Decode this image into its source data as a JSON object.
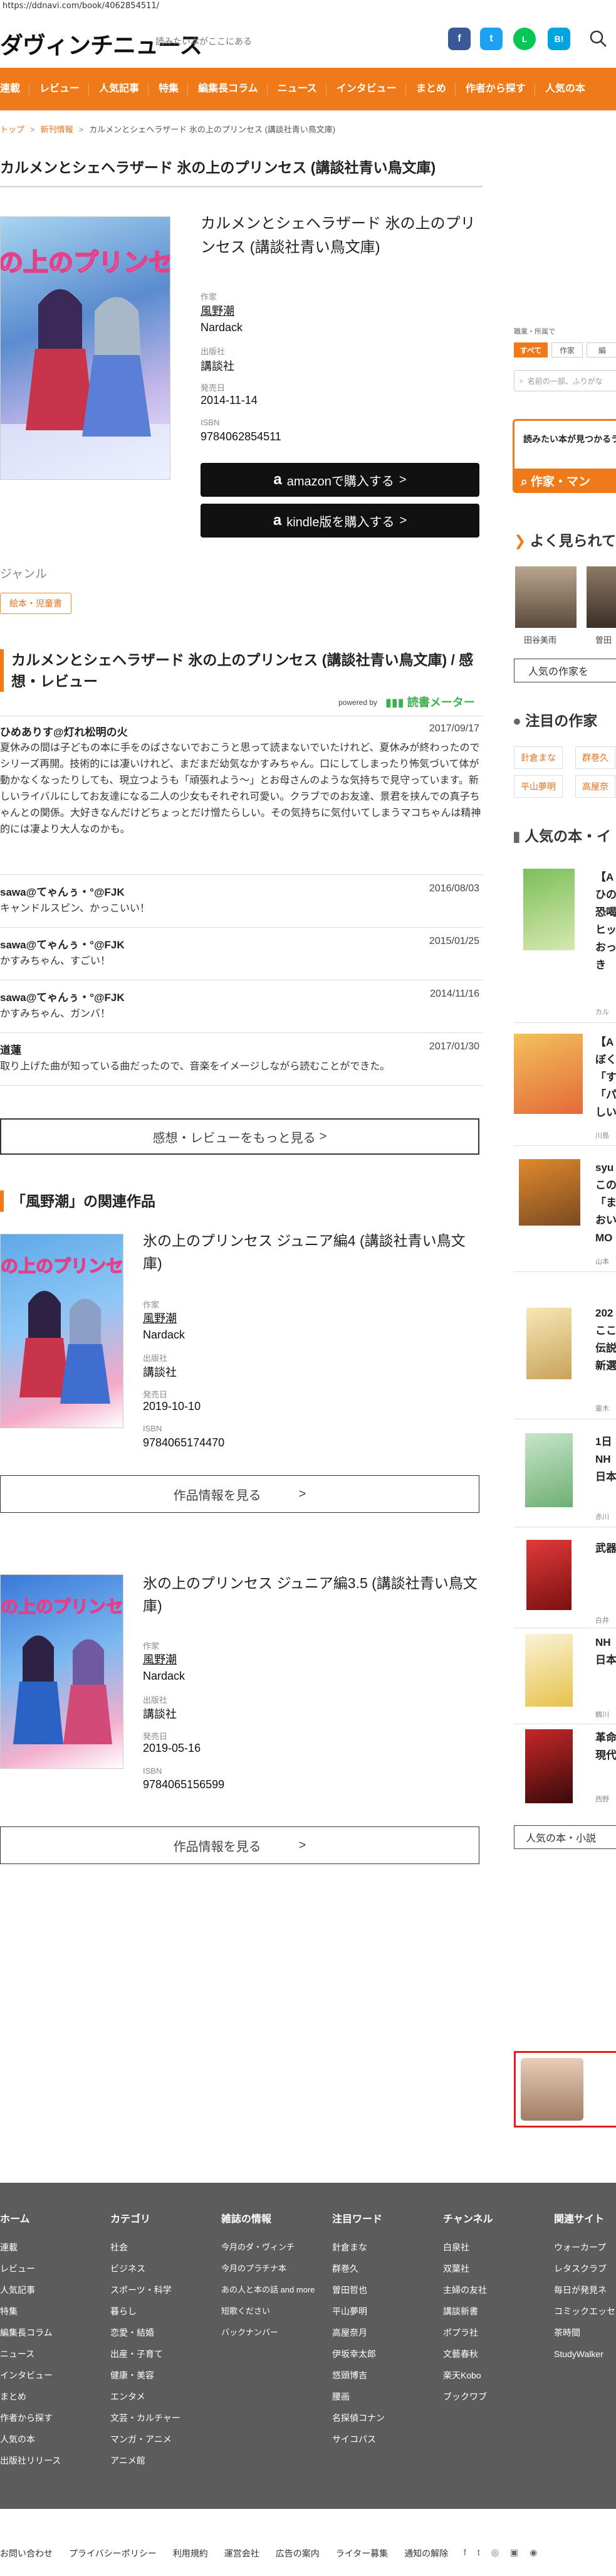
{
  "browser": {
    "url": "https://ddnavi.com/book/4062854511/"
  },
  "header": {
    "logo": "ダヴィンチニュース",
    "tagline": "読みたい本がここにある",
    "social": [
      {
        "name": "facebook-icon",
        "label": "f",
        "color": "#3b5998"
      },
      {
        "name": "twitter-icon",
        "label": "t",
        "color": "#1da1f2"
      },
      {
        "name": "line-icon",
        "label": "L",
        "color": "#06c755"
      },
      {
        "name": "hatena-icon",
        "label": "B!",
        "color": "#00a4de"
      }
    ]
  },
  "nav": [
    "連載",
    "レビュー",
    "人気記事",
    "特集",
    "編集長コラム",
    "ニュース",
    "インタビュー",
    "まとめ",
    "作者から探す",
    "人気の本"
  ],
  "breadcrumb": {
    "home": "トップ",
    "cat": "新刊情報",
    "current": "カルメンとシェヘラザード 氷の上のプリンセス (講談社青い鳥文庫)"
  },
  "page_title": "カルメンとシェヘラザード 氷の上のプリンセス (講談社青い鳥文庫)",
  "book": {
    "title": "カルメンとシェヘラザード 氷の上のプリンセス (講談社青い鳥文庫)",
    "author_label": "作家",
    "author": "風野潮",
    "illustrator": "Nardack",
    "publisher_label": "出版社",
    "publisher": "講談社",
    "release_label": "発売日",
    "release": "2014-11-14",
    "isbn_label": "ISBN",
    "isbn": "9784062854511",
    "amazon_btn": "amazonで購入する",
    "kindle_btn": "kindle版を購入する",
    "cover_text": "氷の上のプリンセス"
  },
  "genre": {
    "label": "ジャンル",
    "tag": "絵本・児童書"
  },
  "reviews": {
    "heading": "カルメンとシェヘラザード 氷の上のプリンセス (講談社青い鳥文庫) / 感想・レビュー",
    "powered": "powered by",
    "bookmeter": "読書メーター",
    "items": [
      {
        "user": "ひめありす@灯れ松明の火",
        "date": "2017/09/17",
        "text": "夏休みの間は子どもの本に手をのばさないでおこうと思って読まないでいたけれど、夏休みが終わったのでシリーズ再開。技術的には凄いけれど、まだまだ幼気なかすみちゃん。口にしてしまったり怖気づいて体が動かなくなったりしても、現立つようも「頑張れよう〜」とお母さんのような気持ちで見守っています。新しいライバルにしてお友達になる二人の少女もそれぞれ可愛い。クラブでのお友達、景君を挟んでの真子ちゃんとの関係。大好きなんだけどちょっとだけ憎たらしい。その気持ちに気付いてしまうマコちゃんは精神的には凄より大人なのかも。"
      },
      {
        "user": "sawa@てゃんぅ・°@FJK",
        "date": "2016/08/03",
        "text": "キャンドルスピン、かっこいい！"
      },
      {
        "user": "sawa@てゃんぅ・°@FJK",
        "date": "2015/01/25",
        "text": "かすみちゃん、すごい！"
      },
      {
        "user": "sawa@てゃんぅ・°@FJK",
        "date": "2014/11/16",
        "text": "かすみちゃん、ガンバ！"
      },
      {
        "user": "道蓮",
        "date": "2017/01/30",
        "text": "取り上げた曲が知っている曲だったので、音楽をイメージしながら読むことができた。"
      }
    ],
    "more": "感想・レビューをもっと見る"
  },
  "related": {
    "heading": "「風野潮」の関連作品",
    "items": [
      {
        "title": "氷の上のプリンセス ジュニア編4 (講談社青い鳥文庫)",
        "author_label": "作家",
        "author": "風野潮",
        "illustrator": "Nardack",
        "publisher_label": "出版社",
        "publisher": "講談社",
        "release_label": "発売日",
        "release": "2019-10-10",
        "isbn_label": "ISBN",
        "isbn": "9784065174470",
        "btn": "作品情報を見る"
      },
      {
        "title": "氷の上のプリンセス ジュニア編3.5 (講談社青い鳥文庫)",
        "author_label": "作家",
        "author": "風野潮",
        "illustrator": "Nardack",
        "publisher_label": "出版社",
        "publisher": "講談社",
        "release_label": "発売日",
        "release": "2019-05-16",
        "isbn_label": "ISBN",
        "isbn": "9784065156599",
        "btn": "作品情報を見る"
      }
    ]
  },
  "sidebar": {
    "filter_label": "職業・所属で",
    "tabs": [
      "すべて",
      "作家",
      "編"
    ],
    "search_placeholder": "名前の一部、ふりがな",
    "banner1": "読みたい本が見つかるラ",
    "banner2": "作家・マン",
    "popular_head": "よく見られてい",
    "people": [
      "田谷美雨",
      "曽田"
    ],
    "people_btn": "人気の作家を",
    "attention_head": "注目の作家",
    "attention_tags": [
      "針倉まな",
      "群巻久",
      "平山夢明",
      "高屋奈"
    ],
    "popular_books_head": "人気の本・イ",
    "books": [
      {
        "l1": "【A",
        "l2": "ひの",
        "l3": "恐喝",
        "l4": "ヒッ",
        "l5": "おっ",
        "l6": "き",
        "src": "カル"
      },
      {
        "l1": "【A",
        "l2": "ぼく",
        "l3": "「す",
        "l4": "「パ",
        "l5": "しい",
        "src": "川島"
      },
      {
        "l1": "syu",
        "l2": "この",
        "l3": "「ま",
        "l4": "おい",
        "l5": "MO",
        "src": "山本"
      },
      {
        "l1": "202",
        "l2": "ここ",
        "l3": "伝説",
        "l4": "新選",
        "src": "童木"
      },
      {
        "l1": "1日",
        "l2": "NH",
        "l3": "日本",
        "src": "赤川"
      },
      {
        "l1": "武器",
        "src": "白井"
      },
      {
        "l1": "NH",
        "l2": "日本",
        "src": "鶴川"
      },
      {
        "l1": "革命",
        "l2": "現代",
        "src": "西野"
      }
    ],
    "books_btn": "人気の本・小説"
  },
  "footer": {
    "cols": [
      {
        "h": "ホーム",
        "items": [
          "連載",
          "レビュー",
          "人気記事",
          "特集",
          "編集長コラム",
          "ニュース",
          "インタビュー",
          "まとめ",
          "作者から探す",
          "人気の本",
          "出版社リリース"
        ]
      },
      {
        "h": "カテゴリ",
        "items": [
          "社会",
          "ビジネス",
          "スポーツ・科学",
          "暮らし",
          "恋愛・結婚",
          "出産・子育て",
          "健康・美容",
          "エンタメ",
          "文芸・カルチャー",
          "マンガ・アニメ",
          "アニメ館"
        ]
      },
      {
        "h": "雑誌の情報",
        "items": [
          "今月のダ・ヴィンチ",
          "今月のプラチナ本",
          "あの人と本の話 and more",
          "短歌ください",
          "バックナンバー"
        ]
      },
      {
        "h": "注目ワード",
        "items": [
          "針倉まな",
          "群巻久",
          "曽田哲也",
          "平山夢明",
          "高屋奈月",
          "伊坂幸太郎",
          "悠頭博吉",
          "腰画",
          "名探偵コナン",
          "サイコパス"
        ]
      },
      {
        "h": "チャンネル",
        "items": [
          "白泉社",
          "双葉社",
          "主婦の友社",
          "講談新書",
          "ポプラ社",
          "文藝春秋",
          "楽天Kobo",
          "ブックワブ"
        ]
      },
      {
        "h": "関連サイト",
        "items": [
          "ウォーカープ",
          "レタスクラブ",
          "毎日が発見ネ",
          "コミックエッセ",
          "茶時間",
          "StudyWalker"
        ]
      }
    ],
    "bottom": [
      "お問い合わせ",
      "プライバシーポリシー",
      "利用規約",
      "運営会社",
      "広告の案内",
      "ライター募集",
      "通知の解除"
    ]
  }
}
